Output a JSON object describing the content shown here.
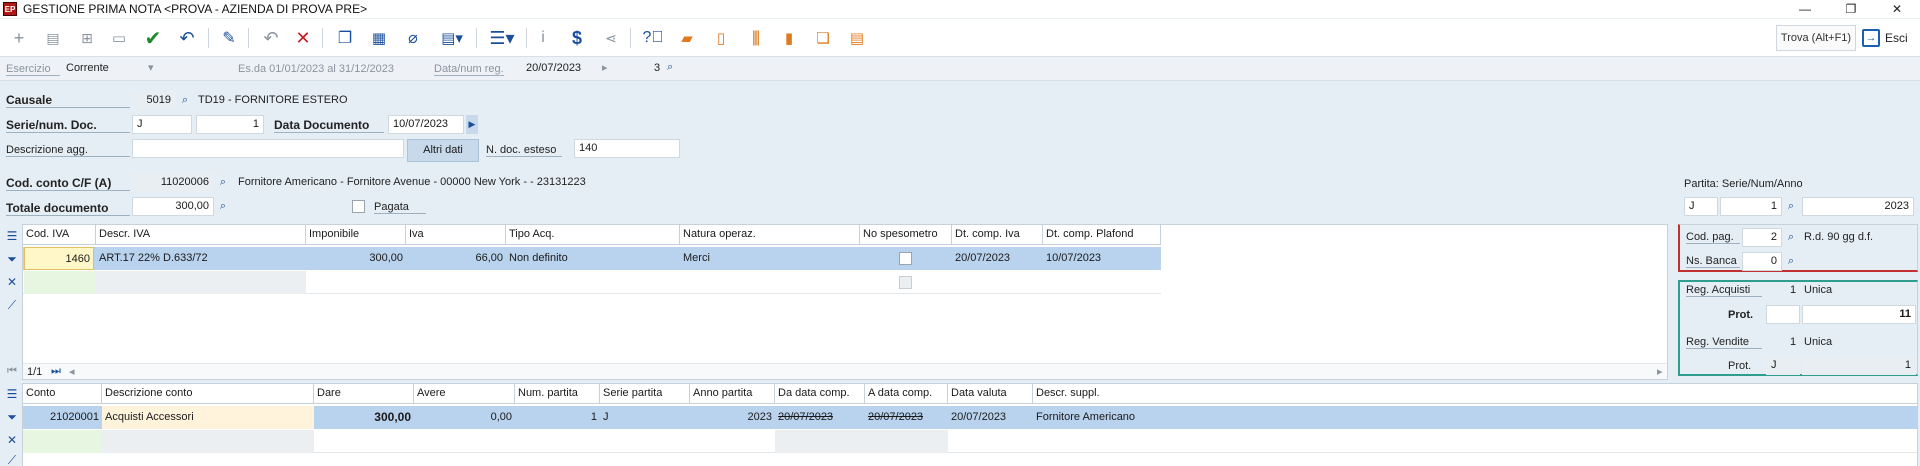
{
  "window": {
    "title": "GESTIONE PRIMA NOTA <PROVA - AZIENDA DI PROVA PRE>",
    "app_icon_text": "EP",
    "min": "—",
    "restore": "❐",
    "close": "✕"
  },
  "toolbar": {
    "icons": [
      "plus-icon",
      "new-document-icon",
      "add-window-icon",
      "open-folder-icon",
      "save-check-icon",
      "undo-icon",
      "edit-pencil-icon",
      "undo-gray-icon",
      "delete-x-icon",
      "copy-icon",
      "calendar-search-icon",
      "attach-icon",
      "document-dropdown-icon",
      "menu-dropdown-icon",
      "info-icon",
      "dollar-icon",
      "share-icon",
      "help-icon",
      "folder-orange-icon",
      "document-search-icon",
      "barcode-icon",
      "document-orange-icon",
      "documents-orange-icon",
      "list-orange-icon"
    ],
    "find_label": "Trova (Alt+F1)",
    "exit_label": "Esci"
  },
  "bar2": {
    "esercizio_label": "Esercizio",
    "esercizio_value": "Corrente",
    "es_range": "Es.da 01/01/2023 al 31/12/2023",
    "data_num_label": "Data/num reg.",
    "data_reg": "20/07/2023",
    "num_reg": "3"
  },
  "form": {
    "causale_label": "Causale",
    "causale_code": "5019",
    "causale_desc": "TD19 - FORNITORE ESTERO",
    "serie_label": "Serie/num. Doc.",
    "serie": "J",
    "num_doc": "1",
    "data_doc_label": "Data Documento",
    "data_doc": "10/07/2023",
    "descr_agg_label": "Descrizione agg.",
    "descr_agg": "",
    "altri_dati": "Altri dati",
    "ndoc_esteso_label": "N. doc. esteso",
    "ndoc_esteso": "140",
    "codconto_label": "Cod. conto C/F  (A)",
    "codconto": "11020006",
    "fornitore_desc": "Fornitore Americano  - Fornitore Avenue - 00000 New York  -  - 23131223",
    "totale_label": "Totale documento",
    "totale": "300,00",
    "pagata_label": "Pagata"
  },
  "iva_grid": {
    "headers": [
      "Cod. IVA",
      "Descr. IVA",
      "Imponibile",
      "Iva",
      "Tipo Acq.",
      "Natura operaz.",
      "No spesometro",
      "Dt. comp. Iva",
      "Dt. comp. Plafond"
    ],
    "row": {
      "cod": "1460",
      "descr": "ART.17 22% D.633/72",
      "imponibile": "300,00",
      "iva": "66,00",
      "tipo": "Non definito",
      "natura": "Merci",
      "dt_iva": "20/07/2023",
      "dt_plafond": "10/07/2023"
    },
    "pager": "1/1"
  },
  "partita": {
    "label": "Partita: Serie/Num/Anno",
    "serie": "J",
    "num": "1",
    "anno": "2023"
  },
  "pagamento": {
    "cod_pag_label": "Cod. pag.",
    "cod_pag": "2",
    "cod_pag_desc": "R.d. 90 gg d.f.",
    "ns_banca_label": "Ns. Banca",
    "ns_banca": "0"
  },
  "registri": {
    "acquisti_label": "Reg. Acquisti",
    "acquisti_num": "1",
    "acquisti_desc": "Unica",
    "prot_label": "Prot.",
    "prot_value": "11",
    "vendite_label": "Reg. Vendite",
    "vendite_num": "1",
    "vendite_desc": "Unica",
    "prot2_label": "Prot.",
    "prot2_serie": "J",
    "prot2_value": "1"
  },
  "conti_grid": {
    "headers": [
      "Conto",
      "Descrizione conto",
      "Dare",
      "Avere",
      "Num. partita",
      "Serie partita",
      "Anno partita",
      "Da data comp.",
      "A data comp.",
      "Data valuta",
      "Descr. suppl."
    ],
    "row": {
      "conto": "21020001",
      "descr": "Acquisti Accessori",
      "dare": "300,00",
      "avere": "0,00",
      "num_partita": "1",
      "serie_partita": "J",
      "anno_partita": "2023",
      "da_data": "20/07/2023",
      "a_data": "20/07/2023",
      "valuta": "20/07/2023",
      "suppl": "Fornitore Americano"
    }
  }
}
